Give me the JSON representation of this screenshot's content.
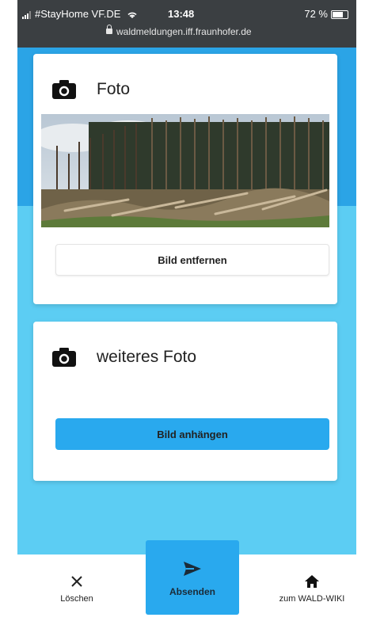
{
  "status_bar": {
    "carrier": "#StayHome VF.DE",
    "time": "13:48",
    "battery": "72 %",
    "url": "waldmeldungen.iff.fraunhofer.de",
    "icons": [
      "signal-icon",
      "wifi-icon",
      "lock-icon",
      "battery-icon"
    ]
  },
  "cards": [
    {
      "title": "Foto",
      "icon": "camera-icon",
      "has_photo": true,
      "button_label": "Bild entfernen"
    },
    {
      "title": "weiteres Foto",
      "icon": "camera-icon",
      "has_photo": false,
      "button_label": "Bild anhängen"
    }
  ],
  "bottom_nav": {
    "delete_label": "Löschen",
    "send_label": "Absenden",
    "home_label": "zum WALD-WIKI",
    "icons": [
      "close-icon",
      "send-icon",
      "home-icon"
    ]
  },
  "colors": {
    "accent": "#29a9ee",
    "background_top": "#2ba4e6",
    "background": "#5ccdf3"
  }
}
